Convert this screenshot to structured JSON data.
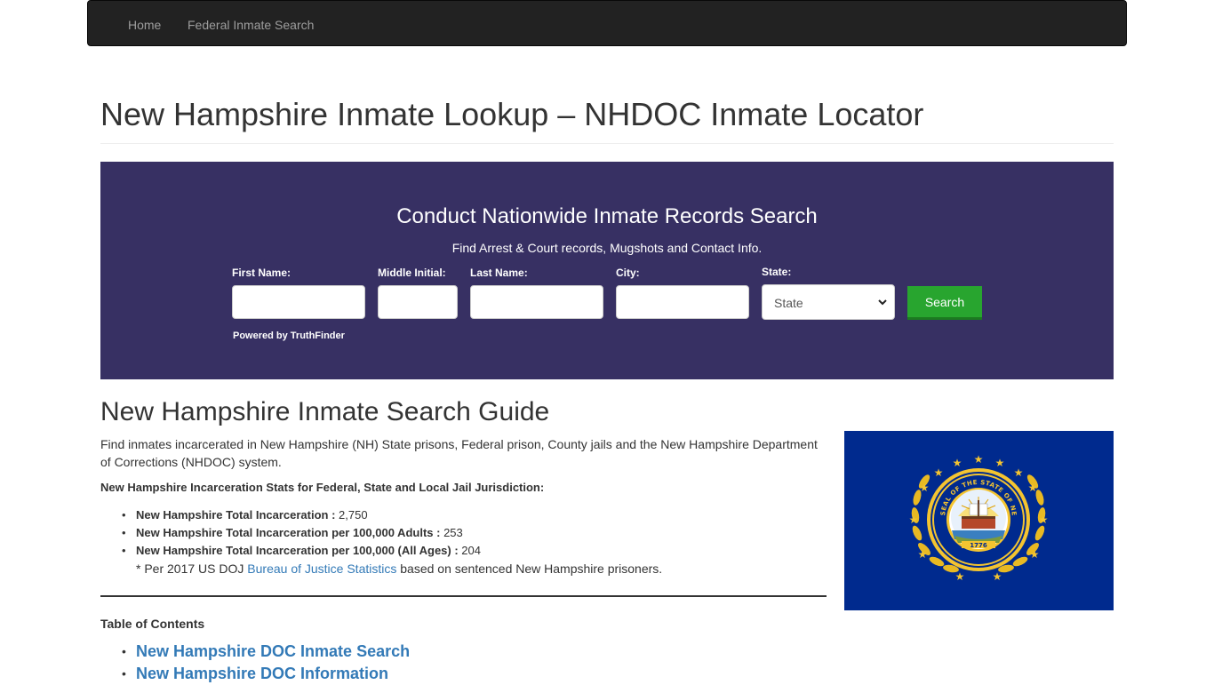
{
  "nav": {
    "items": [
      {
        "label": "Home"
      },
      {
        "label": "Federal Inmate Search"
      }
    ]
  },
  "page": {
    "title": "New Hampshire Inmate Lookup – NHDOC Inmate Locator"
  },
  "search_widget": {
    "title": "Conduct Nationwide Inmate Records Search",
    "subtitle": "Find Arrest & Court records, Mugshots and Contact Info.",
    "fields": {
      "first_name_label": "First Name:",
      "middle_initial_label": "Middle Initial:",
      "last_name_label": "Last Name:",
      "city_label": "City:",
      "state_label": "State:",
      "state_selected": "State"
    },
    "search_button": "Search",
    "powered_by": "Powered by TruthFinder",
    "colors": {
      "background": "#373063",
      "button": "#28a52f"
    }
  },
  "guide": {
    "title": "New Hampshire Inmate Search Guide",
    "intro": "Find inmates incarcerated in New Hampshire (NH) State prisons, Federal prison, County jails and the New Hampshire Department of Corrections (NHDOC) system.",
    "stats_heading": "New Hampshire Incarceration Stats for Federal, State and Local Jail Jurisdiction:",
    "stats": [
      {
        "label": "New Hampshire Total Incarceration  :",
        "value": " 2,750"
      },
      {
        "label": "New Hampshire Total Incarceration per 100,000 Adults :",
        "value": " 253"
      },
      {
        "label": "New Hampshire Total Incarceration per 100,000 (All Ages) :",
        "value": " 204"
      }
    ],
    "footnote_prefix": "* Per 2017 US DOJ ",
    "footnote_link": "Bureau of Justice Statistics",
    "footnote_suffix": " based on sentenced New Hampshire prisoners."
  },
  "flag": {
    "seal_text_top": "SEAL OF THE STATE OF NEW HAMPSHIRE",
    "seal_year": "1776",
    "colors": {
      "field": "#002a8e",
      "gold": "#f4c430"
    }
  },
  "toc": {
    "title": "Table of Contents",
    "items": [
      {
        "label": "New Hampshire DOC Inmate Search"
      },
      {
        "label": "New Hampshire DOC Information"
      }
    ]
  }
}
